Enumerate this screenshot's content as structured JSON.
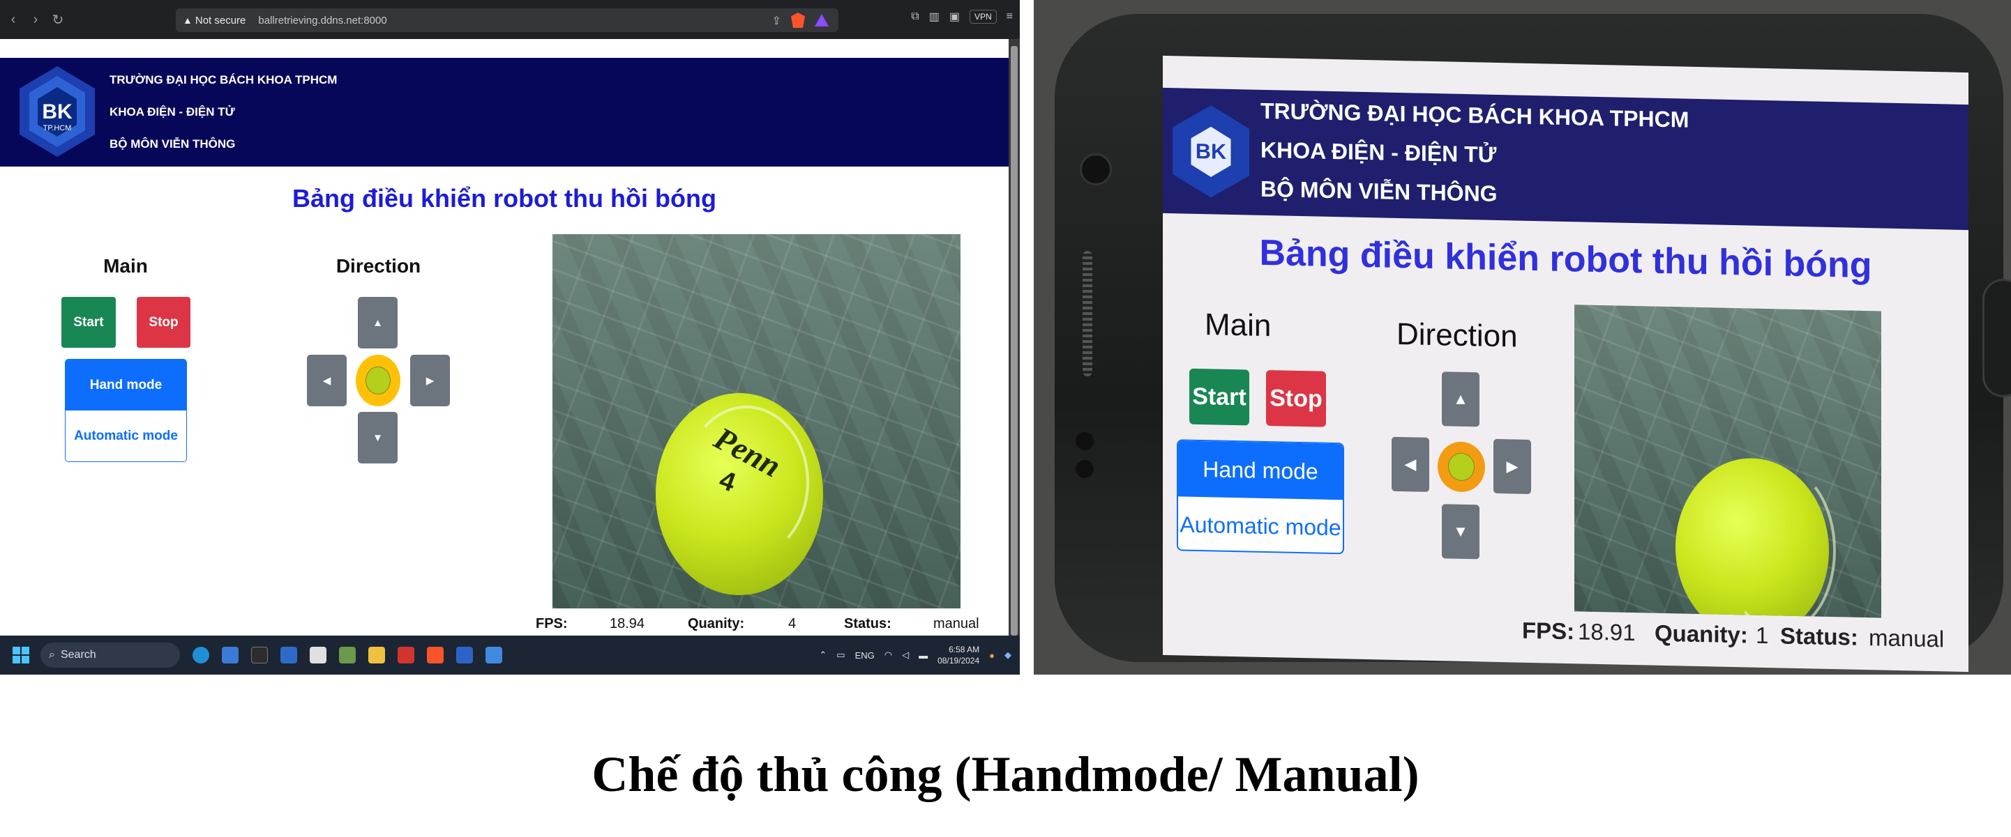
{
  "browser": {
    "security": "Not secure",
    "url": "ballretrieving.ddns.net:8000",
    "vpn": "VPN"
  },
  "header": {
    "logo_text": "BK",
    "logo_sub": "TP.HCM",
    "line1": "TRƯỜNG ĐẠI HỌC BÁCH KHOA TPHCM",
    "line2": "KHOA ĐIỆN - ĐIỆN TỬ",
    "line3": "BỘ MÔN VIỄN THÔNG"
  },
  "page_title": "Bảng điều khiển robot thu hồi bóng",
  "main": {
    "title": "Main",
    "start_label": "Start",
    "stop_label": "Stop",
    "hand_mode_label": "Hand mode",
    "auto_mode_label": "Automatic mode"
  },
  "direction": {
    "title": "Direction",
    "up_icon": "▲",
    "down_icon": "▼",
    "left_icon": "◀",
    "right_icon": "▶"
  },
  "camera": {
    "ball_text": "Penn",
    "ball_number": "4"
  },
  "stats": {
    "fps_label": "FPS:",
    "fps_value": "18.94",
    "quantity_label": "Quanity:",
    "quantity_value": "4",
    "status_label": "Status:",
    "status_value": "manual"
  },
  "taskbar": {
    "search_label": "Search",
    "lang": "ENG",
    "time": "6:58 AM",
    "date": "08/19/2024"
  },
  "phone": {
    "stats": {
      "fps_label": "FPS:",
      "fps_value": "18.91",
      "quantity_label": "Quanity:",
      "quantity_value": "1",
      "status_label": "Status:",
      "status_value": "manual"
    }
  },
  "caption": "Chế độ thủ công (Handmode/ Manual)",
  "colors": {
    "banner": "#07075a",
    "title": "#1c1cd6",
    "start": "#198754",
    "stop": "#dc3545",
    "primary": "#0d6efd",
    "dpad": "#6c757d",
    "center": "#ffc107"
  }
}
